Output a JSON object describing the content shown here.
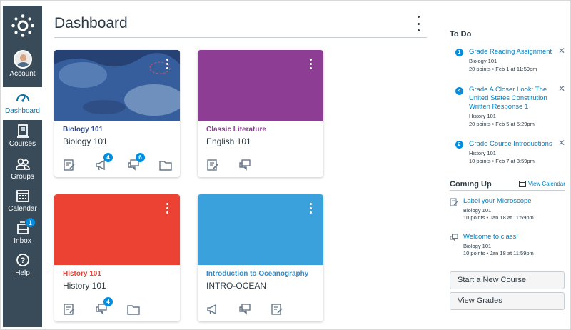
{
  "nav": {
    "account": "Account",
    "dashboard": "Dashboard",
    "courses": "Courses",
    "groups": "Groups",
    "calendar": "Calendar",
    "inbox": "Inbox",
    "inbox_badge": "1",
    "help": "Help"
  },
  "header": {
    "title": "Dashboard"
  },
  "cards": [
    {
      "name": "Biology 101",
      "code": "Biology 101",
      "color": "#2e4b8f",
      "name_color": "#2e4b8f",
      "announce_badge": "4",
      "discuss_badge": "6"
    },
    {
      "name": "Classic Literature",
      "code": "English 101",
      "color": "#8e3d95",
      "name_color": "#8e3d95"
    },
    {
      "name": "History 101",
      "code": "History 101",
      "color": "#ec4233",
      "name_color": "#ec4233",
      "discuss_badge": "4"
    },
    {
      "name": "Introduction to Oceanography",
      "code": "INTRO-OCEAN",
      "color": "#3aa1dd",
      "name_color": "#2f8ccf"
    }
  ],
  "todo": {
    "heading": "To Do",
    "items": [
      {
        "num": "1",
        "title": "Grade Reading Assignment",
        "course": "Biology 101",
        "meta": "20 points • Feb 1 at 11:59pm"
      },
      {
        "num": "4",
        "title": "Grade A Closer Look: The United States Constitution Written Response 1",
        "course": "History 101",
        "meta": "20 points • Feb 5 at 5:29pm"
      },
      {
        "num": "2",
        "title": "Grade Course Introductions",
        "course": "History 101",
        "meta": "10 points • Feb 7 at 3:59pm"
      }
    ]
  },
  "coming_up": {
    "heading": "Coming Up",
    "view_calendar": "View Calendar",
    "items": [
      {
        "title": "Label your Microscope",
        "course": "Biology 101",
        "meta": "10 points • Jan 18 at 11:59pm",
        "icon": "assignment-icon"
      },
      {
        "title": "Welcome to class!",
        "course": "Biology 101",
        "meta": "10 points • Jan 18 at 11:59pm",
        "icon": "discussion-icon"
      }
    ]
  },
  "buttons": {
    "start_course": "Start a New Course",
    "view_grades": "View Grades"
  }
}
